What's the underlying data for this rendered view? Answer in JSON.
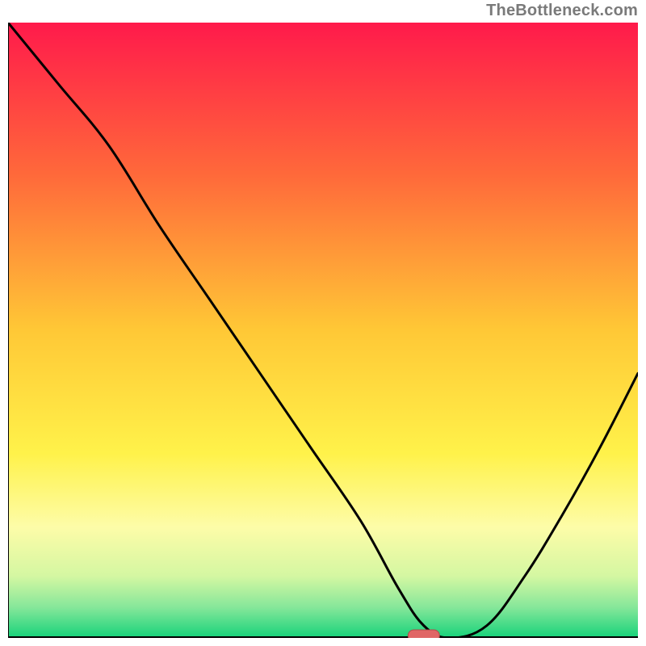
{
  "attribution": "TheBottleneck.com",
  "chart_data": {
    "type": "line",
    "title": "",
    "xlabel": "",
    "ylabel": "",
    "xlim": [
      0,
      100
    ],
    "ylim": [
      0,
      100
    ],
    "x": [
      0,
      8,
      16,
      24,
      32,
      40,
      48,
      56,
      62,
      66,
      70,
      76,
      82,
      88,
      94,
      100
    ],
    "values": [
      100,
      90,
      80,
      67,
      55,
      43,
      31,
      19,
      8,
      2,
      0,
      2,
      10,
      20,
      31,
      43
    ],
    "marker": {
      "x": 66,
      "y": 0,
      "width": 5,
      "height": 2
    },
    "gradient_stops": [
      {
        "offset": 0.0,
        "color": "#ff1a4b"
      },
      {
        "offset": 0.25,
        "color": "#ff6a3a"
      },
      {
        "offset": 0.5,
        "color": "#ffc836"
      },
      {
        "offset": 0.7,
        "color": "#fff24a"
      },
      {
        "offset": 0.82,
        "color": "#fdfca8"
      },
      {
        "offset": 0.9,
        "color": "#d4f7a2"
      },
      {
        "offset": 0.95,
        "color": "#86e79a"
      },
      {
        "offset": 1.0,
        "color": "#16d27a"
      }
    ],
    "colors": {
      "curve": "#000000",
      "axis": "#000000",
      "marker_fill": "#e06666",
      "marker_stroke": "#b24a4a"
    }
  }
}
